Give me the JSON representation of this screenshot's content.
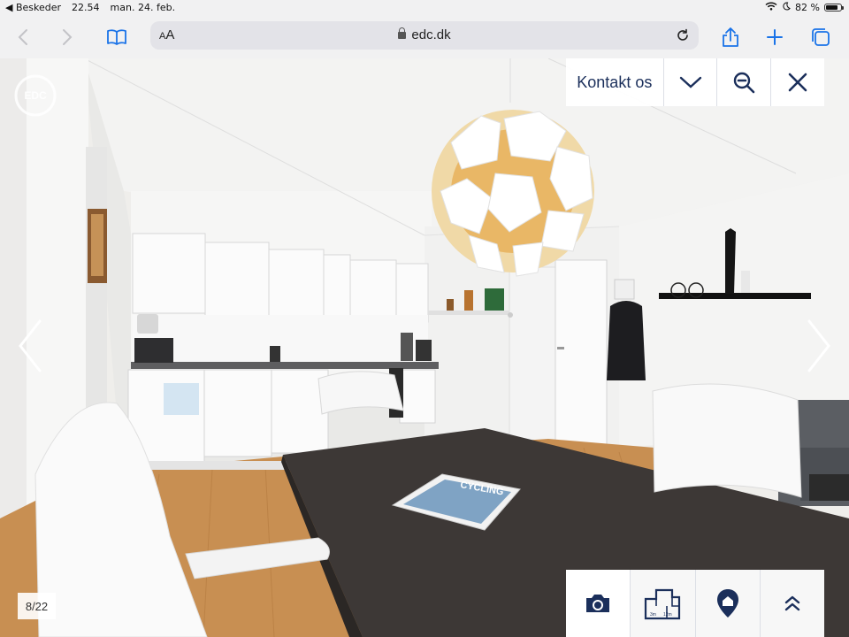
{
  "status_bar": {
    "back_app": "◀ Beskeder",
    "time": "22.54",
    "date": "man. 24. feb.",
    "battery_percent_label": "82 %",
    "battery_level": 0.82
  },
  "browser": {
    "text_size_label": "AA",
    "url": "edc.dk"
  },
  "viewer": {
    "brand_logo_text": "EDC",
    "contact_label": "Kontakt os",
    "photo_counter": "8/22",
    "magazine_title": "CYCLING"
  },
  "icons": {
    "back": "chevron-left-icon",
    "forward": "chevron-right-icon",
    "bookmarks": "book-icon",
    "reload": "reload-icon",
    "share": "share-icon",
    "new_tab": "plus-icon",
    "tabs": "tabs-icon",
    "collapse": "chevron-down-icon",
    "zoom_out": "zoom-out-icon",
    "close": "close-icon",
    "camera": "camera-icon",
    "floorplan": "floorplan-icon",
    "location": "location-pin-icon",
    "scroll_up": "double-chevron-up-icon"
  },
  "colors": {
    "accent_blue": "#1a73e8",
    "brand_navy": "#1b2f5b",
    "toolbar_bg": "#f1f1f2"
  }
}
